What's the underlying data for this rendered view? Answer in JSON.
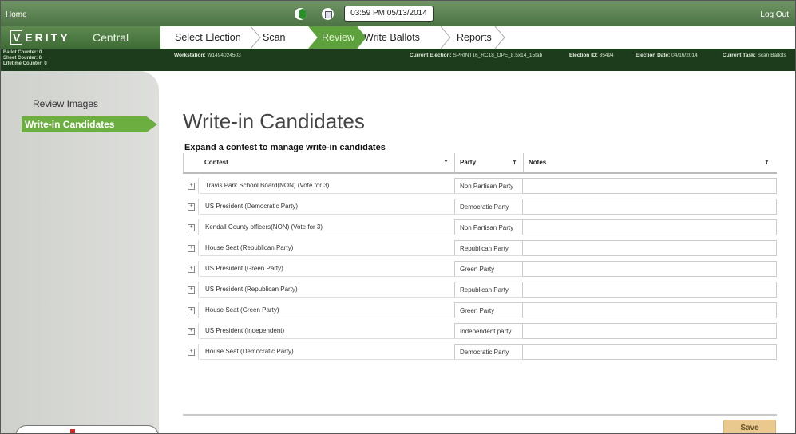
{
  "topbar": {
    "home_link": "Home",
    "logout_link": "Log Out",
    "clock": "03:59 PM 05/13/2014"
  },
  "brand": {
    "logo_v": "V",
    "logo_rest": "ERITY",
    "product": "Central"
  },
  "nav": {
    "steps": [
      "Select Election",
      "Scan",
      "Review",
      "Write Ballots",
      "Reports"
    ],
    "active": "Review"
  },
  "counters": [
    "Ballot Counter: 0",
    "Sheet Counter: 6",
    "Lifetime Counter: 0"
  ],
  "info_bar": {
    "workstation_label": "Workstation:",
    "workstation_value": "W1494024503",
    "election_label": "Current Election:",
    "election_value": "SPRINT16_RC18_OPE_8.5x14_15tab",
    "election_id_label": "Election ID:",
    "election_id_value": "35494",
    "election_date_label": "Election Date:",
    "election_date_value": "04/16/2014",
    "task_label": "Current Task:",
    "task_value": "Scan Ballots"
  },
  "sidebar": {
    "items": [
      "Review Images",
      "Write-in Candidates"
    ],
    "active": "Write-in Candidates"
  },
  "main": {
    "title": "Write-in Candidates",
    "subtitle": "Expand a contest to manage write-in candidates",
    "columns": [
      "Contest",
      "Party",
      "Notes"
    ],
    "rows": [
      {
        "contest": "Travis Park School Board(NON) (Vote for 3)",
        "party": "Non Partisan Party",
        "notes": ""
      },
      {
        "contest": "US President (Democratic Party)",
        "party": "Democratic Party",
        "notes": ""
      },
      {
        "contest": "Kendall County officers(NON) (Vote for 3)",
        "party": "Non Partisan Party",
        "notes": ""
      },
      {
        "contest": "House Seat (Republican Party)",
        "party": "Republican Party",
        "notes": ""
      },
      {
        "contest": "US President (Green Party)",
        "party": "Green Party",
        "notes": ""
      },
      {
        "contest": "US President (Republican Party)",
        "party": "Republican Party",
        "notes": ""
      },
      {
        "contest": "House Seat (Green Party)",
        "party": "Green Party",
        "notes": ""
      },
      {
        "contest": "US President (Independent)",
        "party": "Independent party",
        "notes": ""
      },
      {
        "contest": "House Seat (Democratic Party)",
        "party": "Democratic Party",
        "notes": ""
      }
    ],
    "save_label": "Save"
  },
  "colors": {
    "header_green": "#4c7344",
    "active_green": "#6cae3f",
    "info_dark": "#1d3c1c",
    "save_bg": "#e9c98e"
  },
  "icons": [
    "moon-icon",
    "calendar-icon",
    "expand-icon",
    "filter-icon"
  ]
}
